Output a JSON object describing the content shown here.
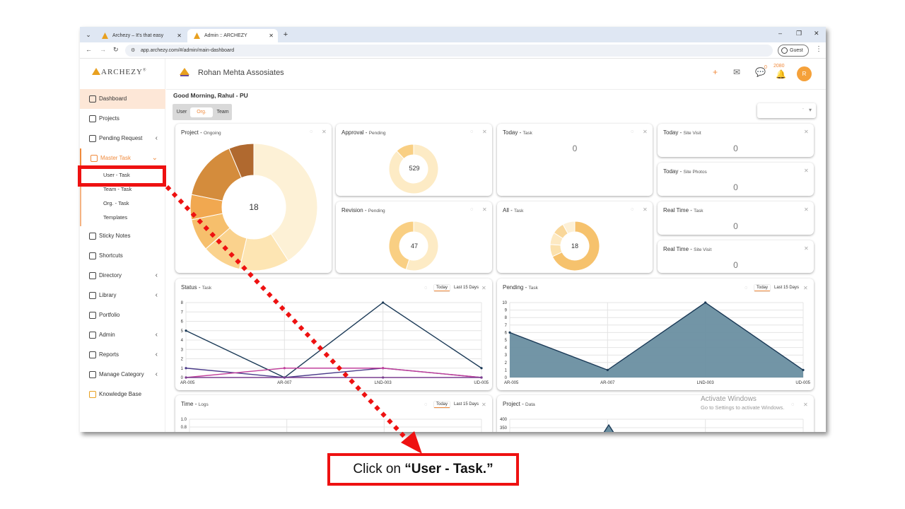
{
  "browser": {
    "tabs": [
      {
        "label": "Archezy – It's that easy",
        "active": false
      },
      {
        "label": "Admin :: ARCHEZY",
        "active": true
      }
    ],
    "new_tab": "+",
    "url": "app.archezy.com/#/admin/main-dashboard",
    "guest_label": "Guest",
    "window_controls": [
      "–",
      "❐",
      "✕"
    ]
  },
  "sidebar": {
    "logo": "ARCHEZY",
    "logo_mark": "®",
    "items": [
      {
        "label": "Dashboard",
        "icon": "home-icon"
      },
      {
        "label": "Projects",
        "icon": "projects-icon"
      },
      {
        "label": "Pending Request",
        "icon": "pending-icon"
      },
      {
        "label": "Master Task",
        "icon": "task-list-icon"
      },
      {
        "label": "Sticky Notes",
        "icon": "sticky-note-icon"
      },
      {
        "label": "Shortcuts",
        "icon": "shortcut-icon"
      },
      {
        "label": "Directory",
        "icon": "directory-icon"
      },
      {
        "label": "Library",
        "icon": "library-icon"
      },
      {
        "label": "Portfolio",
        "icon": "portfolio-icon"
      },
      {
        "label": "Admin",
        "icon": "admin-icon"
      },
      {
        "label": "Reports",
        "icon": "reports-icon"
      },
      {
        "label": "Manage Category",
        "icon": "category-icon"
      },
      {
        "label": "Knowledge Base",
        "icon": "knowledge-icon"
      }
    ],
    "sub_items": [
      "User - Task",
      "Team - Task",
      "Org. - Task",
      "Templates"
    ]
  },
  "topbar": {
    "org_name": "Rohan Mehta Assosiates",
    "plus": "+",
    "chat_count": "0",
    "notif_count": "2080",
    "avatar": "R"
  },
  "greeting": "Good Morning, Rahul - PU",
  "segments": [
    "User",
    "Org.",
    "Team"
  ],
  "dropdown_value": "-",
  "cards": {
    "project": {
      "title": "Project - ",
      "sub": "Ongoing",
      "value": "18"
    },
    "approval": {
      "title": "Approval - ",
      "sub": "Pending",
      "value": "529"
    },
    "revision": {
      "title": "Revision - ",
      "sub": "Pending",
      "value": "47"
    },
    "today_task": {
      "title": "Today - ",
      "sub": "Task",
      "value": "0"
    },
    "all_task": {
      "title": "All - ",
      "sub": "Task",
      "value": "18"
    },
    "today_visit": {
      "title": "Today - ",
      "sub": "Site Visit",
      "value": "0"
    },
    "today_photos": {
      "title": "Today - ",
      "sub": "Site Photos",
      "value": "0"
    },
    "rt_task": {
      "title": "Real Time - ",
      "sub": "Task",
      "value": "0"
    },
    "rt_visit": {
      "title": "Real Time - ",
      "sub": "Site Visit",
      "value": "0"
    },
    "status": {
      "title": "Status - ",
      "sub": "Task"
    },
    "pending": {
      "title": "Pending - ",
      "sub": "Task"
    },
    "time": {
      "title": "Time - ",
      "sub": "Logs"
    },
    "project_data": {
      "title": "Project - ",
      "sub": "Data"
    }
  },
  "chips": {
    "today": "Today",
    "last15": "Last 15 Days"
  },
  "watermark": {
    "line1": "Activate Windows",
    "line2": "Go to Settings to activate Windows."
  },
  "callout": {
    "prefix": "Click on ",
    "bold": "“User - Task.”"
  },
  "colors": {
    "accent": "#f08a3c",
    "highlight": "#ee1111"
  },
  "chart_data": [
    {
      "type": "pie",
      "title": "Project - Ongoing",
      "center_label": "18",
      "values": [
        45,
        14,
        11,
        9,
        7,
        17,
        7
      ],
      "colors": [
        "#fdf1d6",
        "#fde5b3",
        "#fad28d",
        "#f6bf6c",
        "#f1a850",
        "#d48c3c",
        "#b0692f"
      ]
    },
    {
      "type": "pie",
      "title": "Approval - Pending",
      "center_label": "529",
      "values": [
        88,
        12
      ],
      "colors": [
        "#fdebc5",
        "#f9cf83"
      ]
    },
    {
      "type": "pie",
      "title": "Revision - Pending",
      "center_label": "47",
      "values": [
        55,
        45
      ],
      "colors": [
        "#fdebc5",
        "#f9cf83"
      ]
    },
    {
      "type": "pie",
      "title": "All - Task",
      "center_label": "18",
      "values": [
        68,
        8,
        8,
        8,
        8
      ],
      "colors": [
        "#f6c26d",
        "#fbe1ad",
        "#fde9c2",
        "#f9d79a",
        "#fdf0d6"
      ]
    },
    {
      "type": "line",
      "title": "Status - Task",
      "categories": [
        "AR-005",
        "AR-007",
        "LND-003",
        "UD-005"
      ],
      "ylim": [
        0,
        8
      ],
      "yticks": [
        0,
        1,
        2,
        3,
        4,
        5,
        6,
        7,
        8
      ],
      "series": [
        {
          "values": [
            5,
            0,
            8,
            1
          ],
          "color": "#1b3a57"
        },
        {
          "values": [
            1,
            0,
            1,
            0
          ],
          "color": "#4b3b8a"
        },
        {
          "values": [
            0,
            1,
            1,
            0
          ],
          "color": "#c2409c"
        },
        {
          "values": [
            0,
            0,
            0,
            0
          ],
          "color": "#7a3f90"
        }
      ]
    },
    {
      "type": "area",
      "title": "Pending - Task",
      "categories": [
        "AR-005",
        "AR-007",
        "LND-003",
        "UD-005"
      ],
      "ylim": [
        0,
        10
      ],
      "yticks": [
        0,
        1,
        2,
        3,
        4,
        5,
        6,
        7,
        8,
        9,
        10
      ],
      "series": [
        {
          "values": [
            6,
            1,
            10,
            1
          ],
          "color": "#1b3a57",
          "fill": "#6a8fa1"
        }
      ]
    },
    {
      "type": "line",
      "title": "Time - Logs",
      "yticks_visible": [
        "1.0",
        "0.8"
      ]
    },
    {
      "type": "area",
      "title": "Project - Data",
      "yticks_visible": [
        "400",
        "350"
      ]
    }
  ]
}
